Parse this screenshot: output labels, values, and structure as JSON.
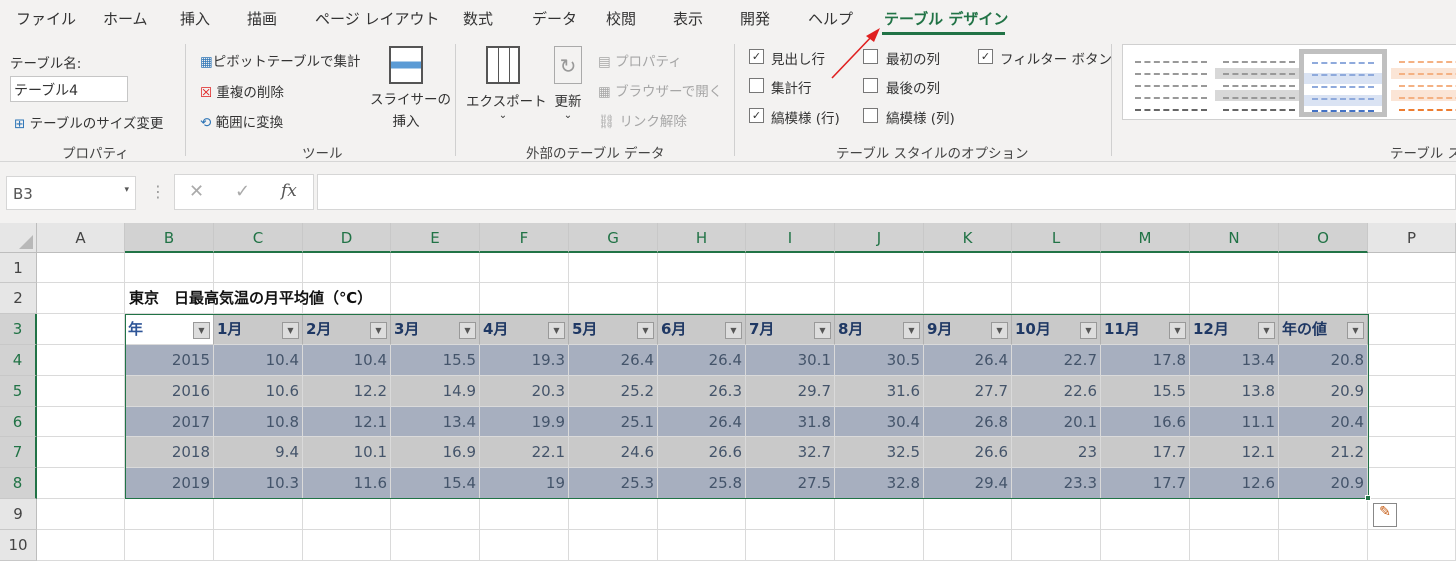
{
  "tabs": [
    "ファイル",
    "ホーム",
    "挿入",
    "描画",
    "ページ レイアウト",
    "数式",
    "データ",
    "校閲",
    "表示",
    "開発",
    "ヘルプ",
    "テーブル デザイン"
  ],
  "active_tab": "テーブル デザイン",
  "ribbon": {
    "properties": {
      "table_name_label": "テーブル名:",
      "table_name": "テーブル4",
      "resize": "テーブルのサイズ変更",
      "group": "プロパティ"
    },
    "tools": {
      "pivot": "ピボットテーブルで集計",
      "remove_dup": "重複の削除",
      "convert": "範囲に変換",
      "slicer1": "スライサーの",
      "slicer2": "挿入",
      "group": "ツール"
    },
    "external": {
      "export": "エクスポート",
      "refresh": "更新",
      "properties": "プロパティ",
      "open_browser": "ブラウザーで開く",
      "unlink": "リンク解除",
      "group": "外部のテーブル データ"
    },
    "style_options": {
      "header_row": {
        "label": "見出し行",
        "checked": true
      },
      "total_row": {
        "label": "集計行",
        "checked": false
      },
      "banded_rows": {
        "label": "縞模様 (行)",
        "checked": true
      },
      "first_col": {
        "label": "最初の列",
        "checked": false
      },
      "last_col": {
        "label": "最後の列",
        "checked": false
      },
      "banded_cols": {
        "label": "縞模様 (列)",
        "checked": false
      },
      "filter_button": {
        "label": "フィルター ボタン",
        "checked": true
      },
      "group": "テーブル スタイルのオプション"
    },
    "styles_group": "テーブル ス"
  },
  "formula_bar": {
    "name_box": "B3",
    "fx": "fx",
    "formula": ""
  },
  "columns": [
    "A",
    "B",
    "C",
    "D",
    "E",
    "F",
    "G",
    "H",
    "I",
    "J",
    "K",
    "L",
    "M",
    "N",
    "O",
    "P"
  ],
  "rows": [
    "1",
    "2",
    "3",
    "4",
    "5",
    "6",
    "7",
    "8",
    "9",
    "10"
  ],
  "sheet": {
    "title": "東京　日最高気温の月平均値（℃）",
    "headers": [
      "年",
      "1月",
      "2月",
      "3月",
      "4月",
      "5月",
      "6月",
      "7月",
      "8月",
      "9月",
      "10月",
      "11月",
      "12月",
      "年の値"
    ],
    "data": [
      [
        "2015",
        "10.4",
        "10.4",
        "15.5",
        "19.3",
        "26.4",
        "26.4",
        "30.1",
        "30.5",
        "26.4",
        "22.7",
        "17.8",
        "13.4",
        "20.8"
      ],
      [
        "2016",
        "10.6",
        "12.2",
        "14.9",
        "20.3",
        "25.2",
        "26.3",
        "29.7",
        "31.6",
        "27.7",
        "22.6",
        "15.5",
        "13.8",
        "20.9"
      ],
      [
        "2017",
        "10.8",
        "12.1",
        "13.4",
        "19.9",
        "25.1",
        "26.4",
        "31.8",
        "30.4",
        "26.8",
        "20.1",
        "16.6",
        "11.1",
        "20.4"
      ],
      [
        "2018",
        "9.4",
        "10.1",
        "16.9",
        "22.1",
        "24.6",
        "26.6",
        "32.7",
        "32.5",
        "26.6",
        "23",
        "17.7",
        "12.1",
        "21.2"
      ],
      [
        "2019",
        "10.3",
        "11.6",
        "15.4",
        "19",
        "25.3",
        "25.8",
        "27.5",
        "32.8",
        "29.4",
        "23.3",
        "17.7",
        "12.6",
        "20.9"
      ]
    ]
  },
  "colors": {
    "accent": "#217346",
    "band_odd": "#a7afbf",
    "band_even": "#c9c9c9",
    "header_text": "#1f3864",
    "arrow": "#e02020"
  }
}
